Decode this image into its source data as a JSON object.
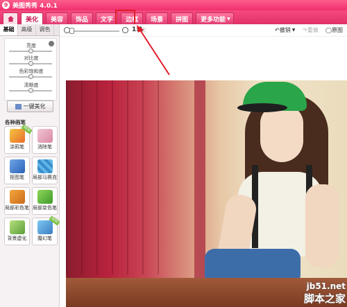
{
  "app": {
    "title": "美图秀秀 4.0.1",
    "logo_glyph": "9"
  },
  "menu": {
    "home_icon": "home-icon",
    "tabs": [
      "美化",
      "美容",
      "饰品",
      "文字",
      "边框",
      "场景",
      "拼图"
    ],
    "more_label": "更多功能",
    "active_tab": "美化",
    "highlighted_tab": "边框"
  },
  "sidebar": {
    "subtabs": [
      "基础",
      "高级",
      "调色"
    ],
    "adjust": {
      "brightness": "亮度",
      "contrast": "对比度",
      "saturation": "色彩饱和度",
      "sharpness": "清晰度"
    },
    "one_key_label": "一键美化",
    "brush_heading": "各种画笔",
    "tools": [
      "涂鸦笔",
      "消除笔",
      "抠图笔",
      "局部马赛克",
      "局部彩色笔",
      "局部变色笔",
      "背景虚化",
      "魔幻笔"
    ],
    "ribbon_label": "NEW"
  },
  "toolbar": {
    "ratio_label": "1:1",
    "ratio_suffix": "太",
    "undo_label": "撤销",
    "redo_label": "重做",
    "original_label": "原图"
  },
  "watermark": {
    "line1": "jb51.net",
    "line2": "脚本之家"
  },
  "colors": {
    "brand_pink": "#f0366f",
    "highlight_red": "#e11b2a"
  }
}
